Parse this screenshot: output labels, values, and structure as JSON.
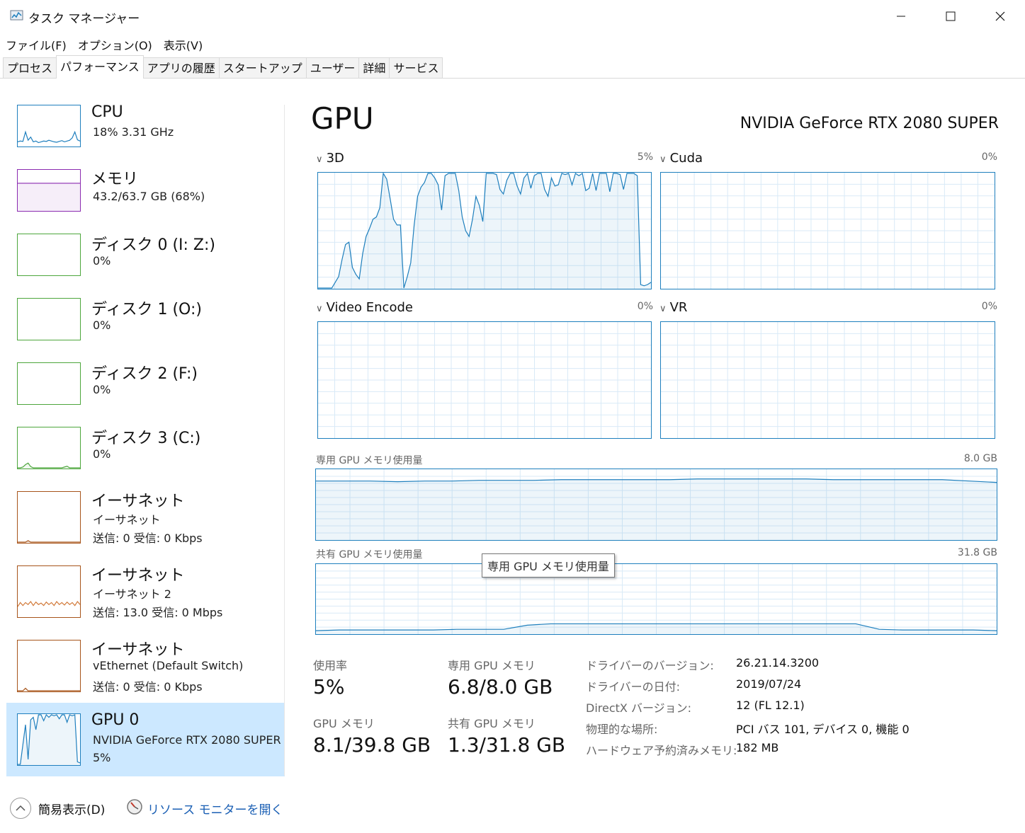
{
  "window": {
    "title": "タスク マネージャー"
  },
  "menu": [
    "ファイル(F)",
    "オプション(O)",
    "表示(V)"
  ],
  "tabs": [
    "プロセス",
    "パフォーマンス",
    "アプリの履歴",
    "スタートアップ",
    "ユーザー",
    "詳細",
    "サービス"
  ],
  "active_tab": "パフォーマンス",
  "sidebar": [
    {
      "title": "CPU",
      "line1": "18%  3.31 GHz",
      "line2": "",
      "color": "#1f7fbe"
    },
    {
      "title": "メモリ",
      "line1": "43.2/63.7 GB (68%)",
      "line2": "",
      "color": "#8b2bb0"
    },
    {
      "title": "ディスク 0 (I: Z:)",
      "line1": "0%",
      "line2": "",
      "color": "#4da63c"
    },
    {
      "title": "ディスク 1 (O:)",
      "line1": "0%",
      "line2": "",
      "color": "#4da63c"
    },
    {
      "title": "ディスク 2 (F:)",
      "line1": "0%",
      "line2": "",
      "color": "#4da63c"
    },
    {
      "title": "ディスク 3 (C:)",
      "line1": "0%",
      "line2": "",
      "color": "#4da63c"
    },
    {
      "title": "イーサネット",
      "line1": "イーサネット",
      "line2": "送信: 0  受信: 0 Kbps",
      "color": "#a7541a"
    },
    {
      "title": "イーサネット",
      "line1": "イーサネット 2",
      "line2": "送信: 13.0  受信: 0 Mbps",
      "color": "#a7541a"
    },
    {
      "title": "イーサネット",
      "line1": "vEthernet (Default Switch)",
      "line2": "送信: 0  受信: 0 Kbps",
      "color": "#a7541a"
    },
    {
      "title": "GPU 0",
      "line1": "NVIDIA GeForce RTX 2080 SUPER",
      "line2": "5%",
      "color": "#1f7fbe",
      "selected": true
    }
  ],
  "main": {
    "title": "GPU",
    "gpu_name": "NVIDIA GeForce RTX 2080 SUPER",
    "engines": [
      {
        "label": "3D",
        "pct": "5%"
      },
      {
        "label": "Cuda",
        "pct": "0%"
      },
      {
        "label": "Video Encode",
        "pct": "0%"
      },
      {
        "label": "VR",
        "pct": "0%"
      }
    ],
    "dedicated_mem_label": "専用 GPU メモリ使用量",
    "dedicated_mem_max": "8.0 GB",
    "shared_mem_label": "共有 GPU メモリ使用量",
    "shared_mem_max": "31.8 GB",
    "tooltip": "専用 GPU メモリ使用量"
  },
  "stats": {
    "utilization_label": "使用率",
    "utilization_value": "5%",
    "dedicated_label": "専用 GPU メモリ",
    "dedicated_value": "6.8/8.0 GB",
    "gpu_mem_label": "GPU メモリ",
    "gpu_mem_value": "8.1/39.8 GB",
    "shared_label": "共有 GPU メモリ",
    "shared_value": "1.3/31.8 GB"
  },
  "info": [
    {
      "label": "ドライバーのバージョン:",
      "value": "26.21.14.3200"
    },
    {
      "label": "ドライバーの日付:",
      "value": "2019/07/24"
    },
    {
      "label": "DirectX バージョン:",
      "value": "12 (FL 12.1)"
    },
    {
      "label": "物理的な場所:",
      "value": "PCI バス 101, デバイス 0, 機能 0"
    },
    {
      "label": "ハードウェア予約済みメモリ:",
      "value": "182 MB"
    }
  ],
  "footer": {
    "fewer_details": "簡易表示(D)",
    "resource_monitor": "リソース モニターを開く"
  },
  "colors": {
    "accent": "#1e7fbd",
    "selected_bg": "#cce8ff",
    "grid": "#d9eaf7",
    "link": "#1a5fb4"
  },
  "graph_series": {
    "gpu3d": [
      0,
      0,
      0,
      0,
      0,
      5,
      10,
      25,
      38,
      40,
      18,
      12,
      8,
      30,
      45,
      52,
      60,
      62,
      70,
      100,
      95,
      78,
      60,
      55,
      55,
      0,
      10,
      22,
      55,
      80,
      88,
      92,
      100,
      100,
      96,
      90,
      68,
      98,
      100,
      100,
      100,
      85,
      62,
      50,
      45,
      60,
      80,
      72,
      58,
      100,
      100,
      100,
      99,
      86,
      82,
      94,
      100,
      100,
      89,
      82,
      96,
      100,
      87,
      98,
      100,
      100,
      86,
      80,
      96,
      89,
      90,
      100,
      99,
      100,
      90,
      100,
      98,
      100,
      85,
      87,
      100,
      85,
      100,
      100,
      100,
      84,
      100,
      100,
      99,
      86,
      100,
      100,
      100,
      98,
      3,
      2,
      3,
      5
    ],
    "dedicated_mem": [
      84,
      84,
      84,
      83,
      84,
      84,
      85,
      85,
      85,
      86,
      86,
      86,
      86,
      86,
      87,
      87,
      87,
      87,
      87,
      86,
      86,
      86,
      86,
      86,
      84,
      82
    ],
    "shared_mem": [
      4,
      5,
      5,
      5,
      5,
      5,
      6,
      6,
      6,
      12,
      14,
      14,
      14,
      14,
      14,
      14,
      14,
      14,
      14,
      14,
      14,
      14,
      14,
      14,
      6,
      5,
      5,
      5,
      5,
      4
    ],
    "cpu_thumb": [
      10,
      12,
      11,
      35,
      14,
      22,
      10,
      12,
      8,
      10,
      12,
      11,
      14,
      12,
      10,
      9,
      11,
      13,
      10,
      12,
      14,
      20,
      35,
      15,
      12
    ],
    "mem_thumb": [
      68,
      68,
      68,
      68,
      68,
      68,
      68,
      68,
      68,
      68,
      68,
      68,
      68,
      68,
      68,
      68,
      68,
      68,
      68,
      68,
      68,
      68,
      68,
      68,
      68
    ],
    "disk3_thumb": [
      0,
      0,
      2,
      8,
      12,
      3,
      0,
      0,
      0,
      0,
      0,
      0,
      0,
      0,
      0,
      0,
      0,
      0,
      2,
      4,
      0,
      0,
      0,
      0,
      0
    ],
    "eth1_thumb": [
      0,
      0,
      0,
      0,
      3,
      0,
      0,
      0,
      0,
      0,
      0,
      0,
      0,
      0,
      0,
      0,
      0,
      0,
      0,
      0,
      0,
      0,
      0,
      0,
      0
    ],
    "eth2_thumb": [
      20,
      28,
      22,
      28,
      24,
      30,
      22,
      29,
      24,
      27,
      22,
      29,
      24,
      28,
      22,
      30,
      24,
      28,
      23,
      29,
      24,
      28,
      22,
      30,
      24
    ],
    "eth3_thumb": [
      0,
      0,
      0,
      5,
      0,
      0,
      0,
      0,
      0,
      0,
      0,
      0,
      0,
      0,
      0,
      0,
      0,
      0,
      0,
      0,
      0,
      0,
      0,
      0,
      0
    ],
    "gpu_thumb": [
      0,
      0,
      40,
      80,
      10,
      90,
      95,
      70,
      100,
      100,
      88,
      100,
      95,
      100,
      98,
      100,
      92,
      100,
      100,
      85,
      100,
      98,
      100,
      5,
      3
    ]
  }
}
